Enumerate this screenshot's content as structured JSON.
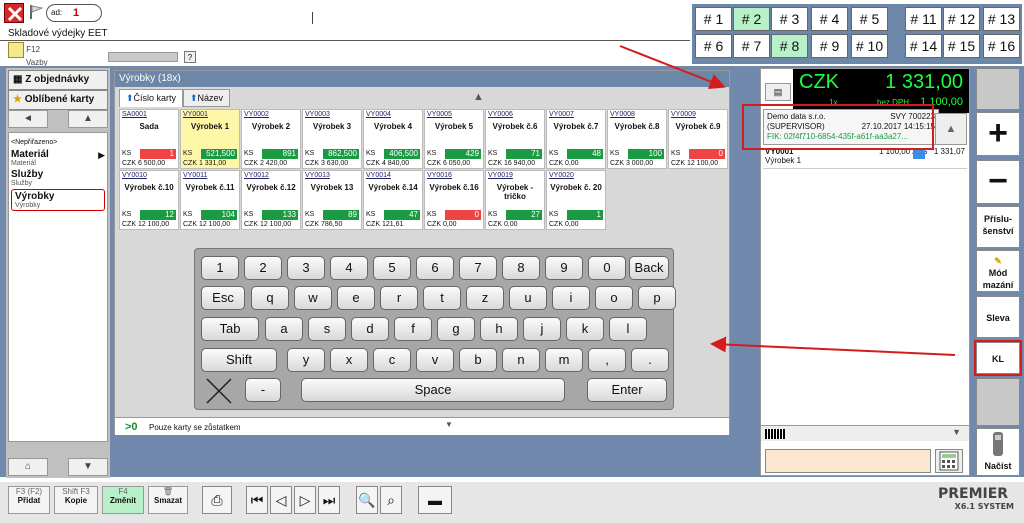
{
  "header": {
    "order_label": "ad:",
    "order_number": "1",
    "title": "Skladové výdejky EET",
    "f12_label": "F12",
    "vazby_label": "Vazby",
    "help_label": "?"
  },
  "slots": [
    "# 1",
    "# 2",
    "# 3",
    "# 4",
    "# 5",
    "# 11",
    "# 12",
    "# 13",
    "# 6",
    "# 7",
    "# 8",
    "# 9",
    "# 10",
    "# 14",
    "# 15",
    "# 16"
  ],
  "sidebar": {
    "from_orders": "Z objednávky",
    "favorites": "Oblíbené karty",
    "unassigned": "<Nepřiřazeno>",
    "items": [
      {
        "title": "Materiál",
        "sub": "Materiál"
      },
      {
        "title": "Služby",
        "sub": "Služby"
      },
      {
        "title": "Výrobky",
        "sub": "Výrobky"
      }
    ]
  },
  "products": {
    "header": "Výrobky (18x)",
    "tab_number": "Číslo karty",
    "tab_name": "Název",
    "cards": [
      {
        "code": "SA0001",
        "name": "Sada",
        "unit": "KS",
        "stock": "1",
        "color": "r",
        "cur": "CZK",
        "price": "6 500,00"
      },
      {
        "code": "VY0001",
        "name": "Výrobek 1",
        "unit": "KS",
        "stock": "521,500",
        "color": "g",
        "cur": "CZK",
        "price": "1 331,00"
      },
      {
        "code": "VY0002",
        "name": "Výrobek 2",
        "unit": "KS",
        "stock": "891",
        "color": "g",
        "cur": "CZK",
        "price": "2 420,00"
      },
      {
        "code": "VY0003",
        "name": "Výrobek 3",
        "unit": "KS",
        "stock": "862,500",
        "color": "g",
        "cur": "CZK",
        "price": "3 630,00"
      },
      {
        "code": "VY0004",
        "name": "Výrobek 4",
        "unit": "KS",
        "stock": "406,500",
        "color": "g",
        "cur": "CZK",
        "price": "4 840,00"
      },
      {
        "code": "VY0005",
        "name": "Výrobek 5",
        "unit": "KS",
        "stock": "429",
        "color": "g",
        "cur": "CZK",
        "price": "6 050,00"
      },
      {
        "code": "VY0006",
        "name": "Výrobek č.6",
        "unit": "KS",
        "stock": "71",
        "color": "g",
        "cur": "CZK",
        "price": "16 940,00"
      },
      {
        "code": "VY0007",
        "name": "Výrobek č.7",
        "unit": "KS",
        "stock": "48",
        "color": "g",
        "cur": "CZK",
        "price": "0,00"
      },
      {
        "code": "VY0008",
        "name": "Výrobek č.8",
        "unit": "KS",
        "stock": "100",
        "color": "g",
        "cur": "CZK",
        "price": "3 000,00"
      },
      {
        "code": "VY0009",
        "name": "Výrobek č.9",
        "unit": "KS",
        "stock": "0",
        "color": "r",
        "cur": "CZK",
        "price": "12 100,00"
      },
      {
        "code": "VY0010",
        "name": "Výrobek č.10",
        "unit": "KS",
        "stock": "12",
        "color": "g",
        "cur": "CZK",
        "price": "12 100,00"
      },
      {
        "code": "VY0011",
        "name": "Výrobek č.11",
        "unit": "KS",
        "stock": "104",
        "color": "g",
        "cur": "CZK",
        "price": "12 100,00"
      },
      {
        "code": "VY0012",
        "name": "Výrobek č.12",
        "unit": "KS",
        "stock": "133",
        "color": "g",
        "cur": "CZK",
        "price": "12 100,00"
      },
      {
        "code": "VY0013",
        "name": "Výrobek 13",
        "unit": "KS",
        "stock": "89",
        "color": "g",
        "cur": "CZK",
        "price": "786,50"
      },
      {
        "code": "VY0014",
        "name": "Výrobek č.14",
        "unit": "KS",
        "stock": "47",
        "color": "g",
        "cur": "CZK",
        "price": "121,61"
      },
      {
        "code": "VY0016",
        "name": "Výrobek č.16",
        "unit": "KS",
        "stock": "0",
        "color": "r",
        "cur": "CZK",
        "price": "0,00"
      },
      {
        "code": "VY0019",
        "name": "Výrobek - tričko",
        "unit": "KS",
        "stock": "27",
        "color": "g",
        "cur": "CZK",
        "price": "0,00"
      },
      {
        "code": "VY0020",
        "name": "Výrobek č. 20",
        "unit": "KS",
        "stock": "1",
        "color": "g",
        "cur": "CZK",
        "price": "0,00"
      }
    ],
    "footer_count": ">0",
    "footer_text": "Pouze karty se zůstatkem"
  },
  "keyboard": {
    "row1": [
      "1",
      "2",
      "3",
      "4",
      "5",
      "6",
      "7",
      "8",
      "9",
      "0",
      "Back"
    ],
    "row2": [
      "Esc",
      "q",
      "w",
      "e",
      "r",
      "t",
      "z",
      "u",
      "i",
      "o",
      "p"
    ],
    "row3": [
      "Tab",
      "a",
      "s",
      "d",
      "f",
      "g",
      "h",
      "j",
      "k",
      "l"
    ],
    "row4": [
      "Shift",
      "y",
      "x",
      "c",
      "v",
      "b",
      "n",
      "m",
      ",",
      "."
    ],
    "row5": [
      "-",
      "Space",
      "Enter"
    ]
  },
  "receipt": {
    "currency": "CZK",
    "total": "1 331,00",
    "label_1": "1x",
    "label_2": "bez DPH",
    "subtotal": "1 100,00",
    "tooltip_company": "Demo data s.r.o.",
    "tooltip_doc": "SVY 700223",
    "tooltip_user": "(SUPERVISOR)",
    "tooltip_date": "27.10.2017 14:15:15",
    "tooltip_fik": "FIK: 02f4f710-6854-435f-a61f-aa3a27...",
    "line_code": "VY0001",
    "line_name": "Výrobek 1",
    "line_qty": "1 100,00 / KS",
    "line_total": "1 331,07"
  },
  "right_buttons": {
    "plus": "+",
    "minus": "−",
    "accessories": "Příslu- šenství",
    "delete_mode": "Mód mazání",
    "discount": "Sleva",
    "kl": "KL",
    "load": "Načíst"
  },
  "toolbar": {
    "add_key": "F3 (F2)",
    "add": "Přidat",
    "copy_key": "Shift F3",
    "copy": "Kopie",
    "change_key": "F4",
    "change": "Změnit",
    "delete": "Smazat"
  },
  "logo": {
    "name": "PREMIER",
    "system": "SYSTEM",
    "version": "X6.1"
  }
}
